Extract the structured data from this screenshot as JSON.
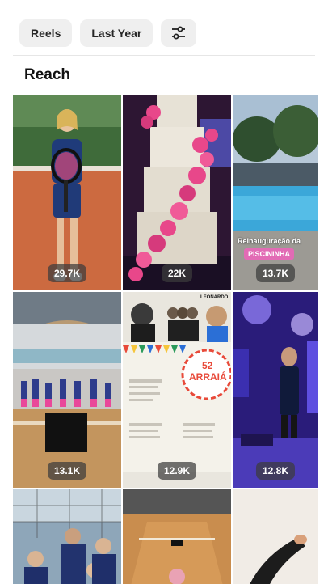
{
  "filters": {
    "reels_label": "Reels",
    "period_label": "Last Year",
    "settings_icon": "sliders-icon"
  },
  "section": {
    "title": "Reach"
  },
  "tiles": [
    {
      "reach": "29.7K",
      "subject": "girl-tennis-player"
    },
    {
      "reach": "22K",
      "subject": "wedding-cake-flowers"
    },
    {
      "reach": "13.7K",
      "subject": "pool-inauguration",
      "caption_line1": "Reinauguração da",
      "caption_line2": "PISCININHA"
    },
    {
      "reach": "13.1K",
      "subject": "kids-volleyball-gym"
    },
    {
      "reach": "12.9K",
      "subject": "arraia-festival-poster",
      "poster_title": "ARRAIÁ",
      "poster_number": "52",
      "poster_name": "LEONARDO"
    },
    {
      "reach": "12.8K",
      "subject": "singer-on-stage"
    },
    {
      "subject": "boys-team-photo"
    },
    {
      "subject": "volleyball-court"
    },
    {
      "subject": "stretching-arm"
    }
  ],
  "colors": {
    "chip_bg": "#efefef",
    "badge_bg": "#3c3c3c",
    "clay": "#c8643a",
    "pink": "#e8478a",
    "stage": "#3a2a9c"
  }
}
